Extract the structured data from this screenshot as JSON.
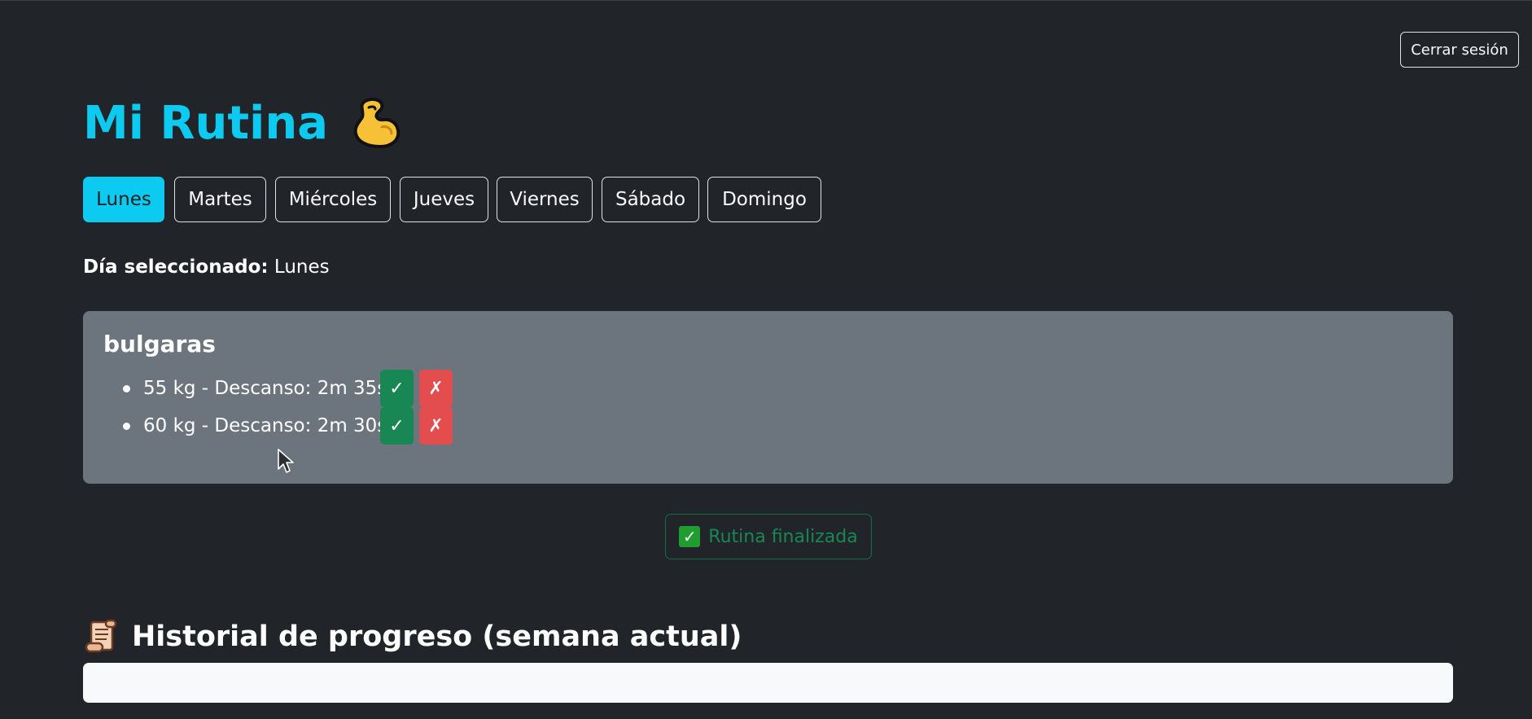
{
  "header": {
    "logout_label": "Cerrar sesión"
  },
  "page": {
    "title": "Mi Rutina",
    "title_icon": "flexed-biceps-icon"
  },
  "days": [
    {
      "label": "Lunes",
      "active": true
    },
    {
      "label": "Martes",
      "active": false
    },
    {
      "label": "Miércoles",
      "active": false
    },
    {
      "label": "Jueves",
      "active": false
    },
    {
      "label": "Viernes",
      "active": false
    },
    {
      "label": "Sábado",
      "active": false
    },
    {
      "label": "Domingo",
      "active": false
    }
  ],
  "selection": {
    "label": "Día seleccionado:",
    "value": "Lunes"
  },
  "exercise": {
    "name": "bulgaras",
    "sets": [
      {
        "text": "55 kg - Descanso: 2m 35s",
        "ok_label": "✓",
        "ko_label": "✗"
      },
      {
        "text": "60 kg - Descanso: 2m 30s",
        "ok_label": "✓",
        "ko_label": "✗"
      }
    ]
  },
  "finish": {
    "icon": "check-mark-button-icon",
    "label": "Rutina finalizada"
  },
  "history": {
    "icon": "scroll-icon",
    "title": "Historial de progreso (semana actual)"
  },
  "colors": {
    "background": "#212529",
    "accent": "#0dcaf0",
    "card": "#6c757d",
    "success": "#198754",
    "danger": "#e44d4d"
  }
}
